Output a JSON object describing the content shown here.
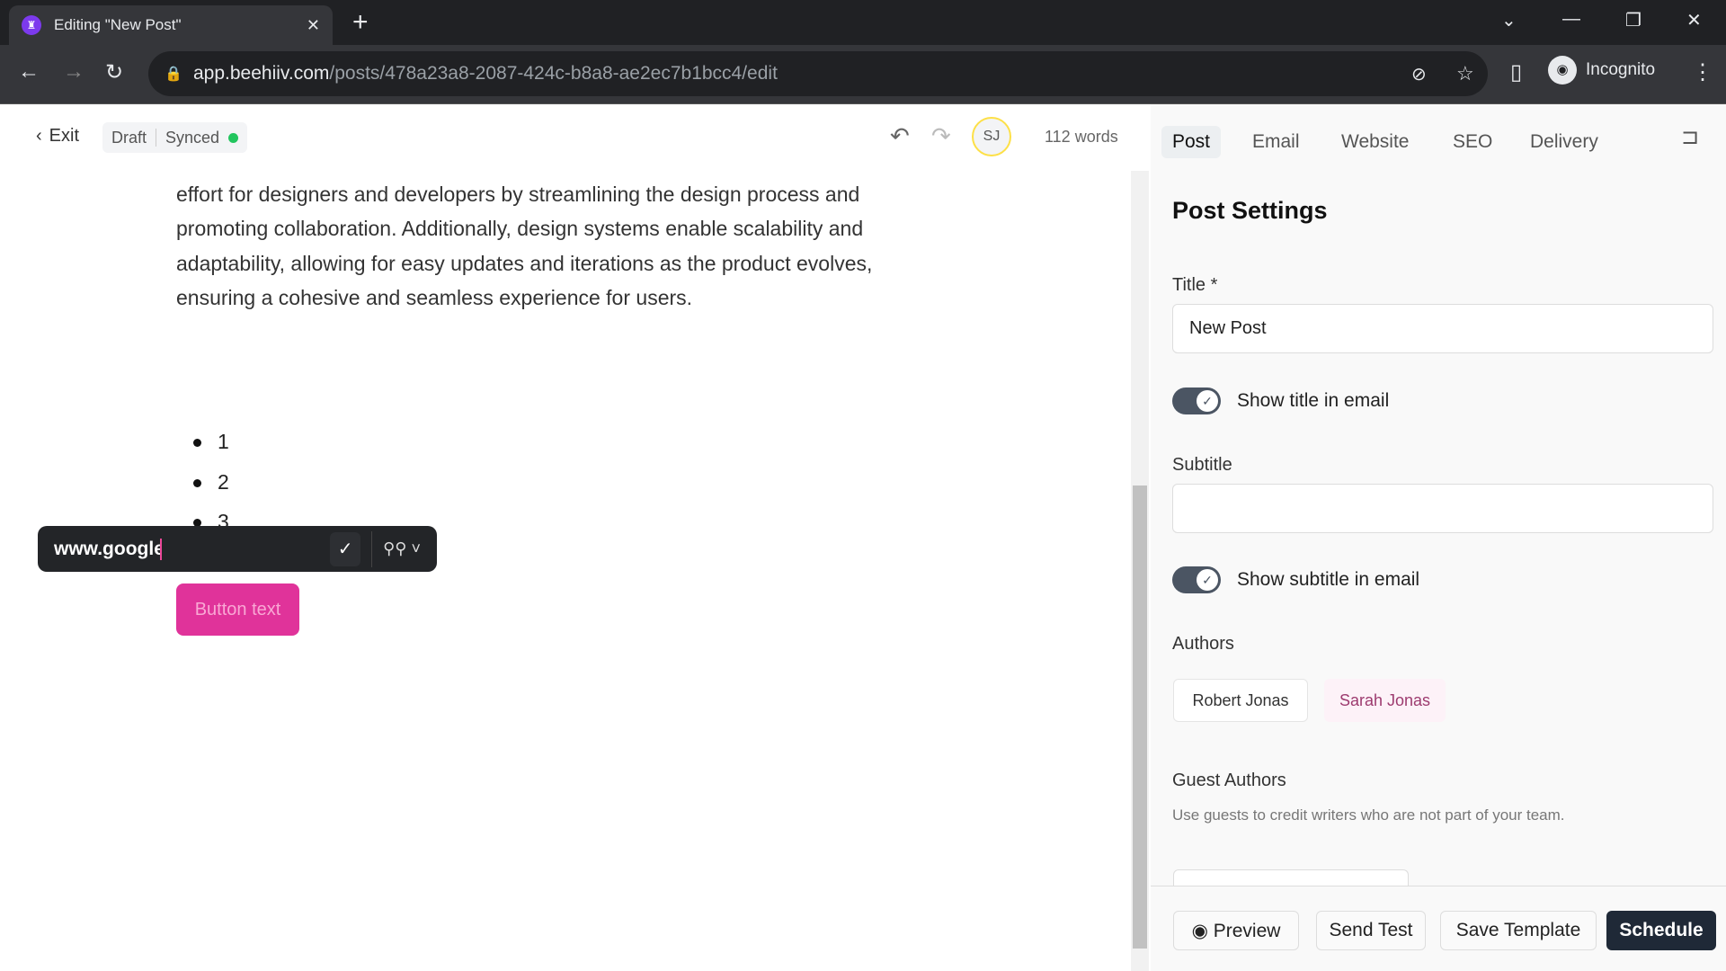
{
  "browser": {
    "tab_title": "Editing \"New Post\"",
    "url_host": "app.beehiiv.com",
    "url_path": "/posts/478a23a8-2087-424c-b8a8-ae2ec7b1bcc4/edit",
    "profile": "Incognito"
  },
  "header": {
    "exit": "Exit",
    "draft": "Draft",
    "synced": "Synced",
    "avatar": "SJ",
    "word_count": "112 words"
  },
  "editor": {
    "paragraph": [
      "effort for designers and developers by streamlining the design process and",
      "promoting collaboration. Additionally, design systems enable scalability and",
      "adaptability, allowing for easy updates and iterations as the product evolves,",
      "ensuring a cohesive and seamless experience for users."
    ],
    "list": [
      "1",
      "2",
      "3"
    ],
    "link_value": "www.google",
    "button_text": "Button text",
    "button_color": "#e0339a"
  },
  "panel": {
    "tabs": [
      "Post",
      "Email",
      "Website",
      "SEO",
      "Delivery"
    ],
    "active_tab": "Post",
    "heading": "Post Settings",
    "title_label": "Title *",
    "title_value": "New Post",
    "show_title": "Show title in email",
    "show_title_on": true,
    "subtitle_label": "Subtitle",
    "subtitle_value": "",
    "show_subtitle": "Show subtitle in email",
    "show_subtitle_on": true,
    "authors_label": "Authors",
    "authors": [
      "Robert Jonas",
      "Sarah Jonas"
    ],
    "guest_label": "Guest Authors",
    "guest_desc": "Use guests to credit writers who are not part of your team."
  },
  "footer": {
    "preview": "Preview",
    "send_test": "Send Test",
    "save_template": "Save Template",
    "schedule": "Schedule"
  }
}
